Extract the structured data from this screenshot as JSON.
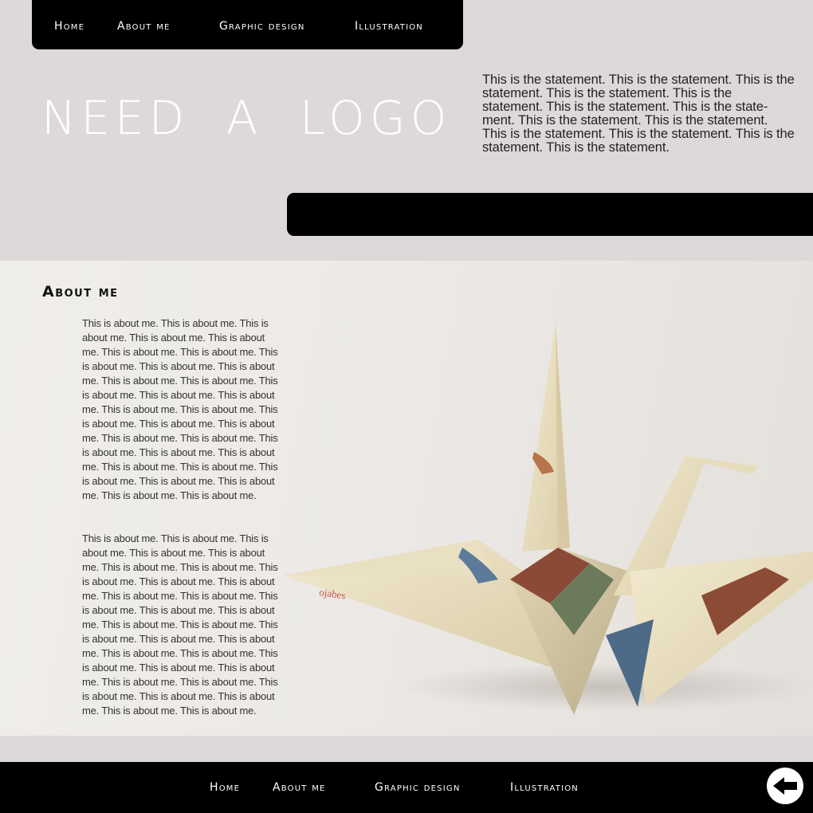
{
  "nav": {
    "items": [
      {
        "label": "Home"
      },
      {
        "label": "About me"
      },
      {
        "label": "Graphic design"
      },
      {
        "label": "Illustration"
      }
    ]
  },
  "hero": {
    "title": "NEED A LOGO",
    "statement": "This is the statement. This is the statement. This is the statement. This is the statement. This is the statement. This is the statement. This is the state-ment. This is the statement. This is the statement. This is the statement. This is the statement. This is the statement. This is the statement."
  },
  "about": {
    "heading": "About me",
    "paragraphs": [
      "This is about me. This is about me. This is about me. This is about me. This is about me. This is about me. This is about me. This is about me. This is about me. This is about me. This is about me. This is about me. This is about me. This is about me. This is about me. This is about me. This is about me. This is about me. This is about me. This is about me. This is about me. This is about me. This is about me. This is about me. This is about me. This is about me. This is about me. This is about me. This is about me. This is about me. This is about me. This is about me.",
      "This is about me. This is about me. This is about me. This is about me. This is about me. This is about me. This is about me. This is about me. This is about me. This is about me. This is about me. This is about me. This is about me. This is about me. This is about me. This is about me. This is about me. This is about me. This is about me. This is about me. This is about me. This is about me. This is about me. This is about me. This is about me. This is about me. This is about me. This is about me. This is about me. This is about me. This is about me. This is about me."
    ],
    "photo_text": "ojabes"
  },
  "footer": {
    "items": [
      {
        "label": "Home"
      },
      {
        "label": "About me"
      },
      {
        "label": "Graphic design"
      },
      {
        "label": "Illustration"
      }
    ],
    "back_icon": "back-arrow-icon"
  },
  "colors": {
    "background": "#ded9d9",
    "bar": "#000000",
    "title": "#ffffff"
  }
}
